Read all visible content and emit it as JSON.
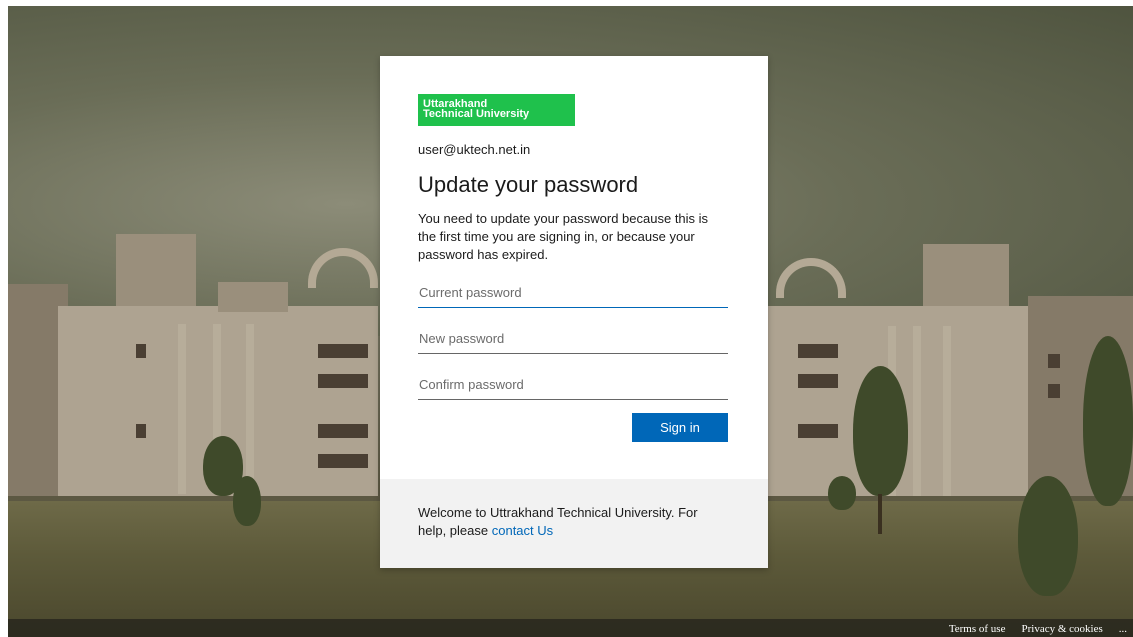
{
  "org": {
    "logo_line1": "Uttarakhand",
    "logo_line2": "Technical University"
  },
  "login": {
    "account": "user@uktech.net.in",
    "title": "Update your password",
    "description": "You need to update your password because this is the first time you are signing in, or because your password has expired.",
    "current_password_placeholder": "Current password",
    "new_password_placeholder": "New password",
    "confirm_password_placeholder": "Confirm password",
    "signin_label": "Sign in"
  },
  "footer": {
    "welcome_text": "Welcome to Uttrakhand Technical University. For help, please ",
    "contact_link": "contact Us"
  },
  "page_footer": {
    "terms": "Terms of use",
    "privacy": "Privacy & cookies",
    "more": "..."
  },
  "colors": {
    "brand_green": "#1fc14c",
    "accent_blue": "#0067b8"
  }
}
